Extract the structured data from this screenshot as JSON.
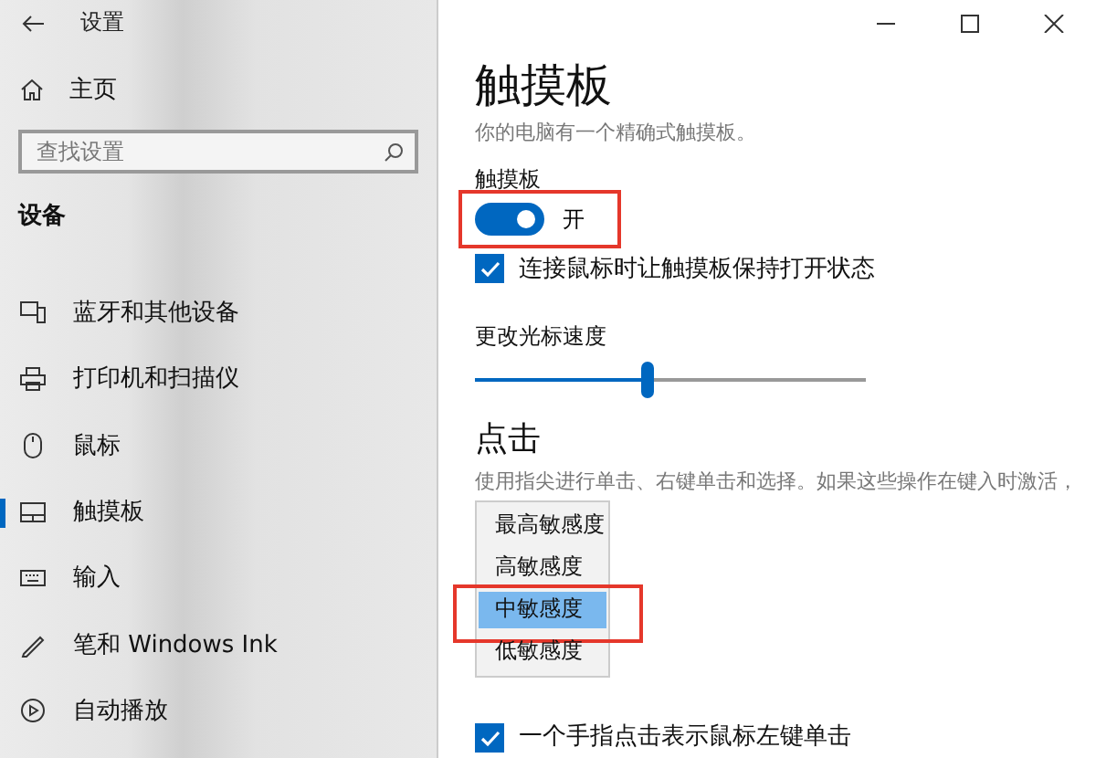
{
  "window": {
    "title": "设置"
  },
  "sidebar": {
    "home": "主页",
    "search": {
      "placeholder": "查找设置"
    },
    "section": "设备",
    "items": [
      {
        "label": "蓝牙和其他设备",
        "selected": false
      },
      {
        "label": "打印机和扫描仪",
        "selected": false
      },
      {
        "label": "鼠标",
        "selected": false
      },
      {
        "label": "触摸板",
        "selected": true
      },
      {
        "label": "输入",
        "selected": false
      },
      {
        "label": "笔和 Windows Ink",
        "selected": false
      },
      {
        "label": "自动播放",
        "selected": false
      }
    ]
  },
  "main": {
    "title": "触摸板",
    "subtitle": "你的电脑有一个精确式触摸板。",
    "toggle": {
      "label": "触摸板",
      "on": true,
      "state_text": "开",
      "highlighted": true
    },
    "keep_on": {
      "label": "连接鼠标时让触摸板保持打开状态",
      "checked": true
    },
    "speed": {
      "label": "更改光标速度",
      "level": 0.44
    },
    "taps": {
      "heading": "点击",
      "description": "使用指尖进行单击、右键单击和选择。如果这些操作在键入时激活，",
      "sensitivity_menu": [
        {
          "label": "最高敏感度",
          "selected": false,
          "highlighted": false
        },
        {
          "label": "高敏感度",
          "selected": false,
          "highlighted": false
        },
        {
          "label": "中敏感度",
          "selected": true,
          "highlighted": true
        },
        {
          "label": "低敏感度",
          "selected": false,
          "highlighted": false
        }
      ],
      "single_tap": {
        "label": "一个手指点击表示鼠标左键单击",
        "checked": true
      }
    }
  }
}
